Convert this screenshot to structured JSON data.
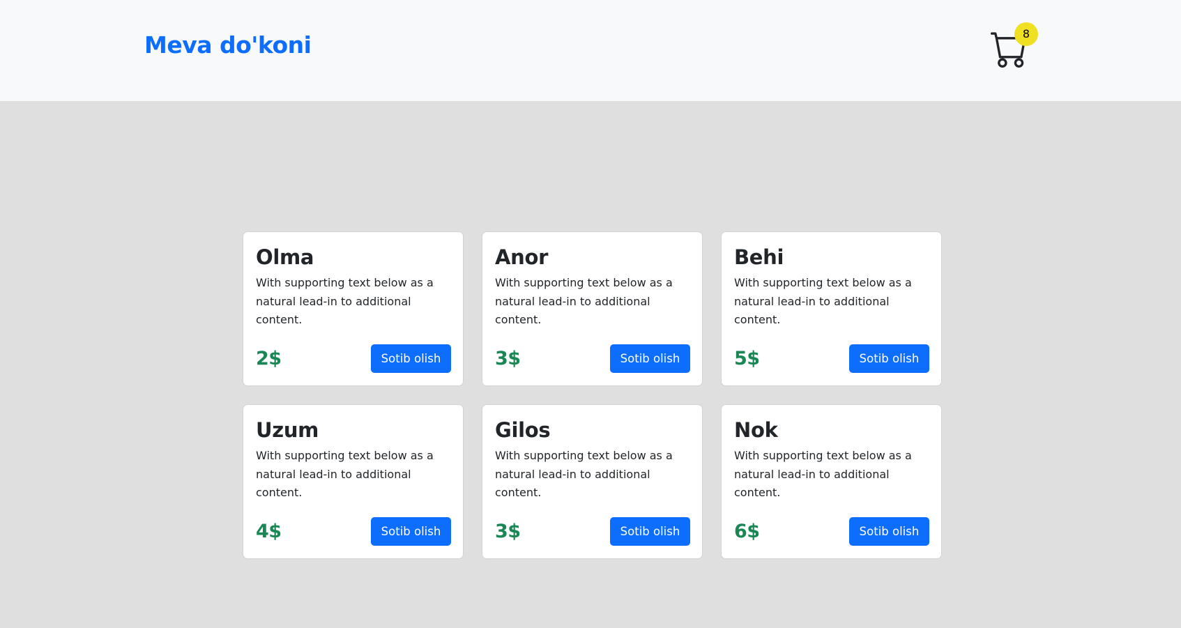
{
  "navbar": {
    "brand": "Meva do'koni",
    "cart": {
      "icon": "cart-icon",
      "count": "8",
      "badge_color": "#f0e024"
    }
  },
  "colors": {
    "primary": "#0d6efd",
    "price": "#198754",
    "page_background": "#dfdfdf",
    "navbar_background": "#f8f9fa"
  },
  "products": [
    {
      "name": "Olma",
      "description": "With supporting text below as a natural lead-in to additional content.",
      "price": "2$",
      "button_label": "Sotib olish"
    },
    {
      "name": "Anor",
      "description": "With supporting text below as a natural lead-in to additional content.",
      "price": "3$",
      "button_label": "Sotib olish"
    },
    {
      "name": "Behi",
      "description": "With supporting text below as a natural lead-in to additional content.",
      "price": "5$",
      "button_label": "Sotib olish"
    },
    {
      "name": "Uzum",
      "description": "With supporting text below as a natural lead-in to additional content.",
      "price": "4$",
      "button_label": "Sotib olish"
    },
    {
      "name": "Gilos",
      "description": "With supporting text below as a natural lead-in to additional content.",
      "price": "3$",
      "button_label": "Sotib olish"
    },
    {
      "name": "Nok",
      "description": "With supporting text below as a natural lead-in to additional content.",
      "price": "6$",
      "button_label": "Sotib olish"
    }
  ]
}
